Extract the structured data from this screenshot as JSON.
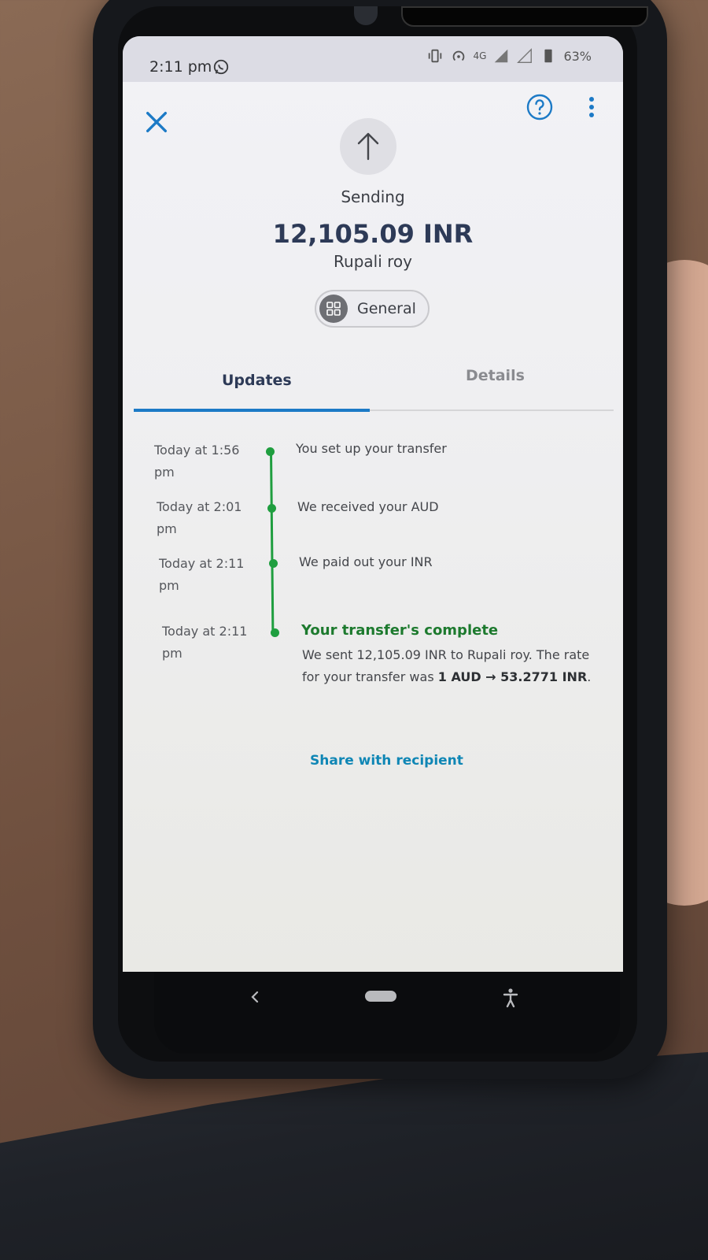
{
  "status_bar": {
    "time": "2:11 pm",
    "network": "4G",
    "battery": "63%"
  },
  "header": {
    "close_icon": "close-icon",
    "help_icon": "help-icon",
    "more_icon": "more-vert-icon"
  },
  "transfer": {
    "state": "Sending",
    "amount": "12,105.09 INR",
    "recipient": "Rupali roy",
    "category": "General"
  },
  "tabs": [
    {
      "label": "Updates",
      "active": true
    },
    {
      "label": "Details",
      "active": false
    }
  ],
  "timeline": [
    {
      "time": "Today at 1:56 pm",
      "event": "You set up your transfer"
    },
    {
      "time": "Today at 2:01 pm",
      "event": "We received your AUD"
    },
    {
      "time": "Today at 2:11 pm",
      "event": "We paid out your INR"
    },
    {
      "time": "Today at 2:11 pm",
      "title": "Your transfer's complete",
      "desc_prefix": "We sent 12,105.09 INR to Rupali roy. The rate for your transfer was ",
      "rate": "1 AUD → 53.2771 INR",
      "desc_suffix": "."
    }
  ],
  "share_label": "Share with recipient",
  "colors": {
    "accent": "#1c7ac6",
    "success": "#1f9e3f",
    "link": "#0f86b5",
    "amount": "#2d3a57"
  }
}
